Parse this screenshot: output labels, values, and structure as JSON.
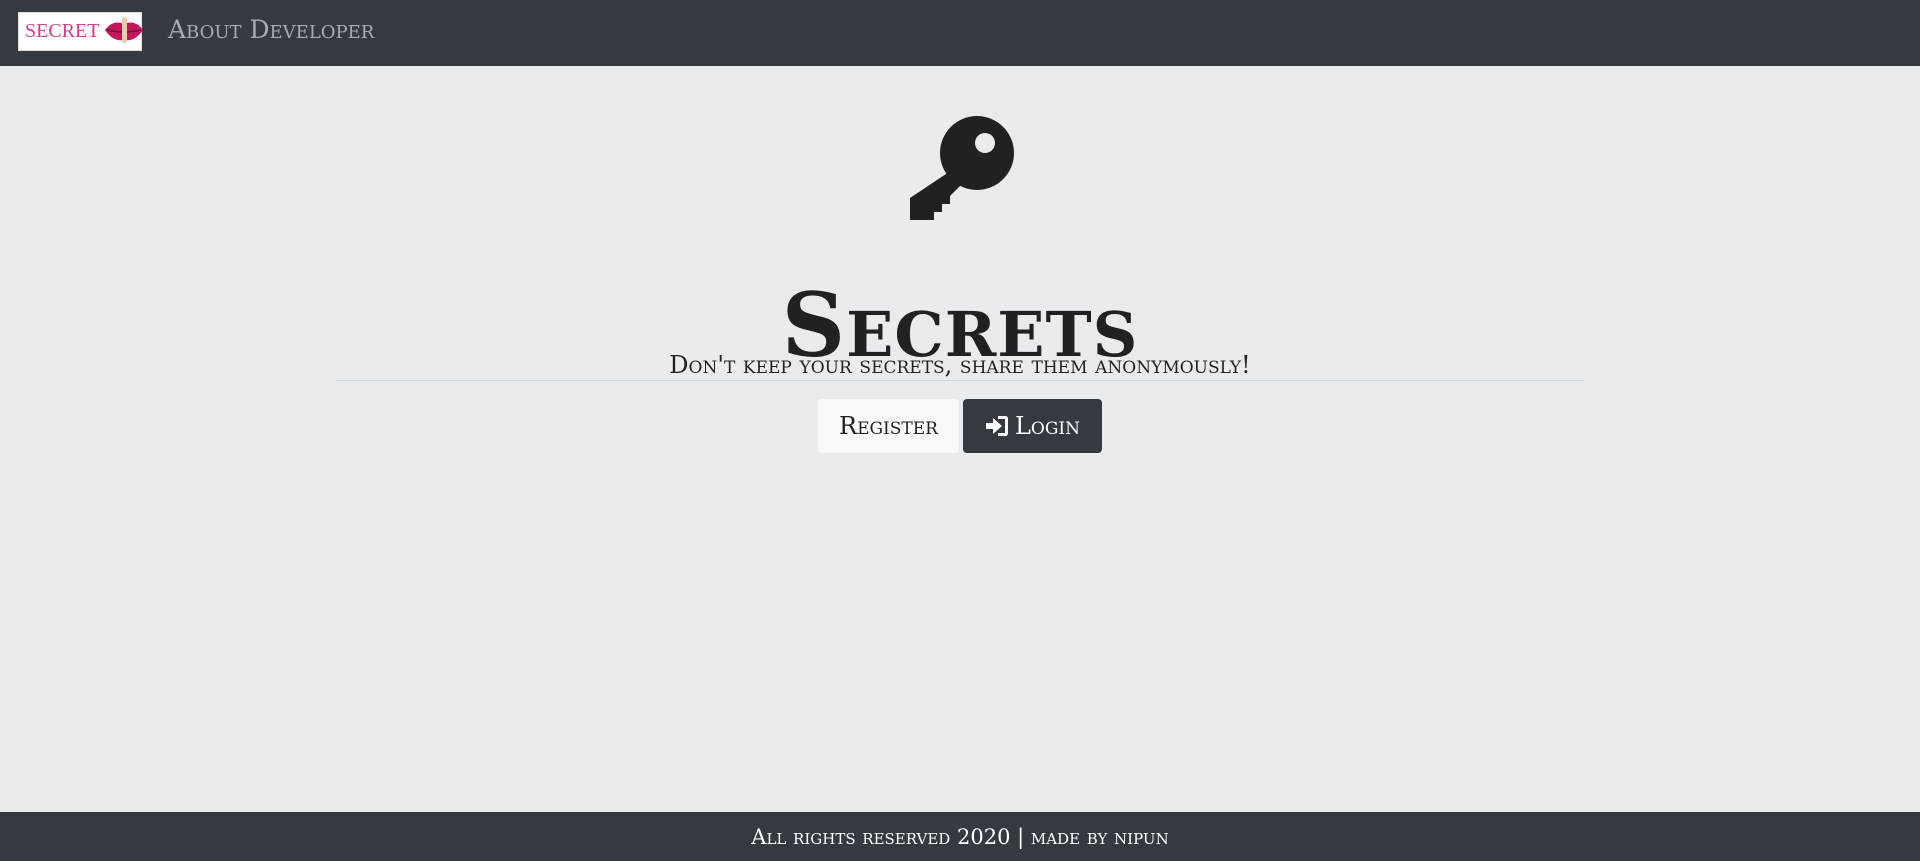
{
  "navbar": {
    "brand_text": "SECRET",
    "brand_icon": "lips-shush-icon",
    "about_link": "About Developer"
  },
  "jumbotron": {
    "icon": "key-icon",
    "title": "Secrets",
    "lead": "Don't keep your secrets, share them anonymously!"
  },
  "buttons": {
    "register_label": "Register",
    "login_label": "Login",
    "login_icon": "sign-in-icon"
  },
  "footer": {
    "text": "All rights reserved 2020 | made by nipun"
  },
  "colors": {
    "navbar_bg": "#343a40",
    "page_bg": "#e9ecef",
    "brand_pink": "#d63a8a"
  }
}
